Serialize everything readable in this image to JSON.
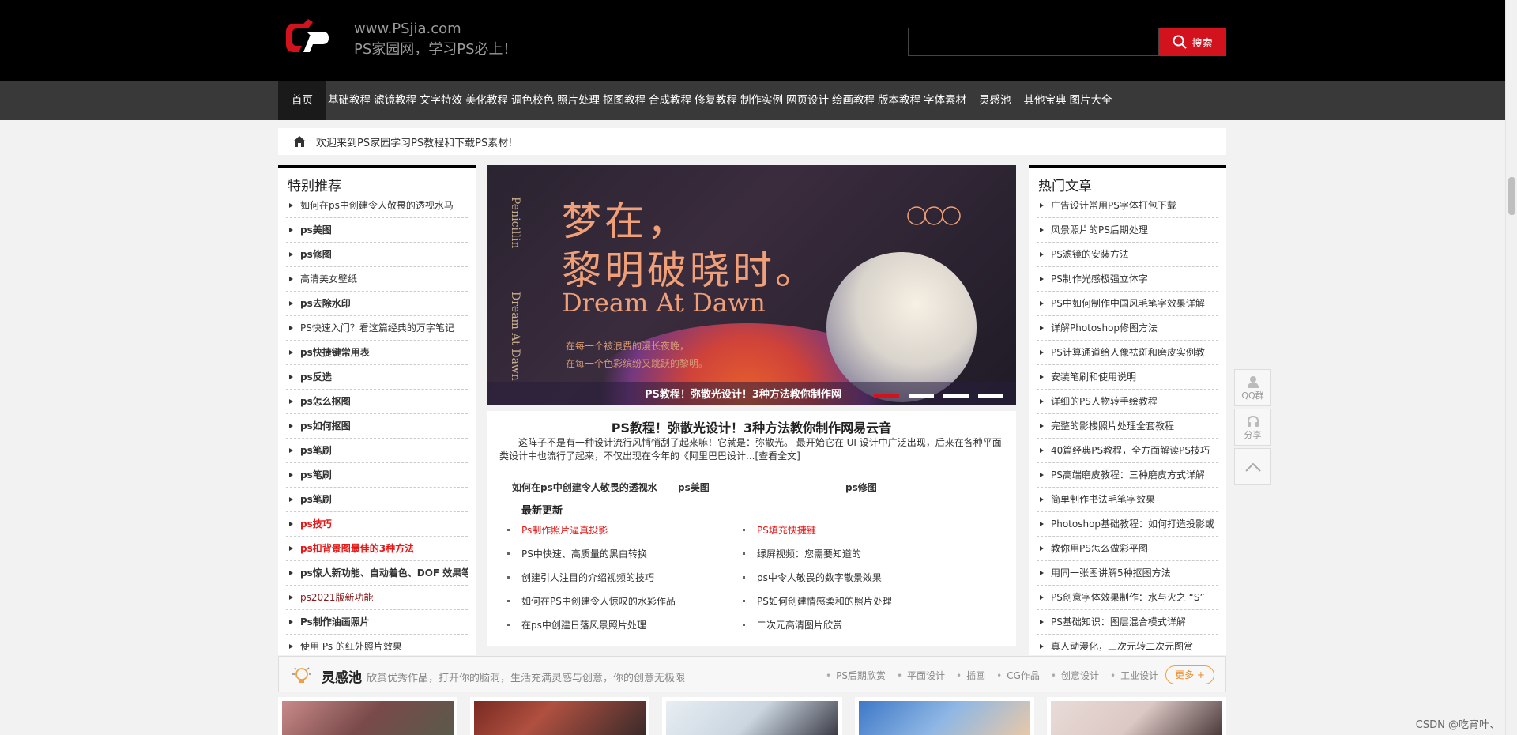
{
  "header": {
    "site_url": "www.PSjia.com",
    "slogan": "PS家园网，学习PS必上！",
    "search_value": "",
    "search_button": "搜索",
    "brand_color": "#d2131e"
  },
  "nav": {
    "items": [
      "首页",
      "基础教程",
      "滤镜教程",
      "文字特效",
      "美化教程",
      "调色校色",
      "照片处理",
      "抠图教程",
      "合成教程",
      "修复教程",
      "制作实例",
      "网页设计",
      "绘画教程",
      "版本教程",
      "字体素材",
      "灵感池",
      "其他宝典",
      "图片大全"
    ]
  },
  "welcome": {
    "text": "欢迎来到PS家园学习PS教程和下载PS素材!"
  },
  "left_sidebar": {
    "title": "特别推荐",
    "items": [
      "如何在ps中创建令人敬畏的透视水马",
      "ps美图",
      "ps修图",
      "高清美女壁纸",
      "ps去除水印",
      "PS快速入门？看这篇经典的万字笔记",
      "ps快捷键常用表",
      "ps反选",
      "ps怎么抠图",
      "ps如何抠图",
      "ps笔刷",
      "ps笔刷",
      "ps笔刷",
      "ps技巧",
      "ps扣背景图最佳的3种方法",
      "ps惊人新功能、自动着色、DOF 效果等",
      "ps2021版新功能",
      "Ps制作油画照片",
      "使用 Ps 的红外照片效果"
    ]
  },
  "banner": {
    "vertical_1": "Penicillin",
    "vertical_2": "Dream At Dawn",
    "headline_1": "梦在，",
    "headline_2": "黎明破晓时。",
    "headline_en": "Dream At Dawn",
    "small_1": "在每一个被浪费的漫长夜晚，",
    "small_2": "在每一个色彩缤纷又跳跃的黎明。",
    "caption": "PS教程！弥散光设计！3种方法教你制作网",
    "slide_count": 4,
    "active_slide": 1
  },
  "article": {
    "title": "PS教程！弥散光设计！3种方法教你制作网易云音",
    "summary": "这阵子不是有一种设计流行风悄悄刮了起来嘛！它就是：弥散光。 最开始它在 UI 设计中广泛出现，后来在各种平面类设计中也流行了起来，不仅出现在今年的《阿里巴巴设计...",
    "more": "[查看全文]",
    "links": [
      "如何在ps中创建令人敬畏的透视水",
      "ps美图",
      "ps修图"
    ]
  },
  "latest": {
    "title": "最新更新",
    "col1": [
      "Ps制作照片逼真投影",
      "PS中快速、高质量的黑白转换",
      "创建引人注目的介绍视频的技巧",
      "如何在PS中创建令人惊叹的水彩作品",
      "在ps中创建日落风景照片处理"
    ],
    "col2": [
      "PS填充快捷键",
      "绿屏视频：您需要知道的",
      "ps中令人敬畏的数字散景效果",
      "PS如何创建情感柔和的照片处理",
      "二次元高清图片欣赏"
    ]
  },
  "right_sidebar": {
    "title": "热门文章",
    "items": [
      "广告设计常用PS字体打包下载",
      "风景照片的PS后期处理",
      "PS滤镜的安装方法",
      "PS制作光感极强立体字",
      "PS中如何制作中国风毛笔字效果详解",
      "详解Photoshop修图方法",
      "PS计算通道给人像祛斑和磨皮实例教",
      "安装笔刷和使用说明",
      "详细的PS人物转手绘教程",
      "完整的影楼照片处理全套教程",
      "40篇经典PS教程，全方面解读PS技巧",
      "PS高端磨皮教程：三种磨皮方式详解",
      "简单制作书法毛笔字效果",
      "Photoshop基础教程：如何打造投影或",
      "教你用PS怎么做彩平图",
      "用同一张图讲解5种抠图方法",
      "PS创意字体效果制作：水与火之 “S”",
      "PS基础知识：图层混合模式详解",
      "真人动漫化，三次元转二次元图赏"
    ]
  },
  "float_tools": {
    "qq_label": "QQ群",
    "share_label": "分享"
  },
  "inspiration": {
    "title": "灵感池",
    "desc": "欣赏优秀作品，打开你的脑洞，生活充满灵感与创意，你的创意无极限",
    "cats": [
      "PS后期欣赏",
      "平面设计",
      "插画",
      "CG作品",
      "创意设计",
      "工业设计"
    ],
    "more": "更多 +"
  },
  "watermark": "CSDN @吃宵叶、"
}
